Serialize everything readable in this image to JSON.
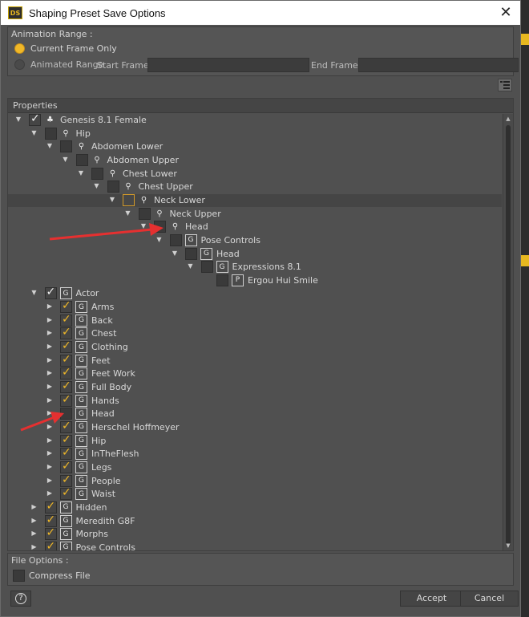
{
  "window": {
    "title": "Shaping Preset Save Options",
    "logo": "DS",
    "close_glyph": "✕"
  },
  "animation_range": {
    "label": "Animation Range :",
    "current_frame_label": "Current Frame Only",
    "animated_range_label": "Animated Range",
    "start_frame_label": "Start Frame :",
    "start_frame_value": "",
    "end_frame_label": "End Frame :",
    "end_frame_value": "",
    "selected": "current_frame"
  },
  "properties": {
    "label": "Properties",
    "rows": [
      {
        "label": "Genesis 8.1 Female",
        "depth": 0,
        "expanded": true,
        "check": "white",
        "icon": "figure-icon"
      },
      {
        "label": "Hip",
        "depth": 1,
        "expanded": true,
        "check": "none",
        "icon": "bone-icon"
      },
      {
        "label": "Abdomen Lower",
        "depth": 2,
        "expanded": true,
        "check": "none",
        "icon": "bone-icon"
      },
      {
        "label": "Abdomen Upper",
        "depth": 3,
        "expanded": true,
        "check": "none",
        "icon": "bone-icon"
      },
      {
        "label": "Chest Lower",
        "depth": 4,
        "expanded": true,
        "check": "none",
        "icon": "bone-icon"
      },
      {
        "label": "Chest Upper",
        "depth": 5,
        "expanded": true,
        "check": "none",
        "icon": "bone-icon"
      },
      {
        "label": "Neck Lower",
        "depth": 6,
        "expanded": true,
        "check": "hover",
        "icon": "bone-icon",
        "highlight": true
      },
      {
        "label": "Neck Upper",
        "depth": 7,
        "expanded": true,
        "check": "none",
        "icon": "bone-icon"
      },
      {
        "label": "Head",
        "depth": 8,
        "expanded": true,
        "check": "none",
        "icon": "bone-icon"
      },
      {
        "label": "Pose Controls",
        "depth": 9,
        "expanded": true,
        "check": "none",
        "icon": "group-icon"
      },
      {
        "label": "Head",
        "depth": 10,
        "expanded": true,
        "check": "none",
        "icon": "group-icon"
      },
      {
        "label": "Expressions 8.1",
        "depth": 11,
        "expanded": true,
        "check": "none",
        "icon": "group-icon"
      },
      {
        "label": "Ergou Hui Smile",
        "depth": 12,
        "expanded": null,
        "check": "none",
        "icon": "property-icon"
      },
      {
        "label": "Actor",
        "depth": 1,
        "expanded": true,
        "check": "white",
        "icon": "group-icon"
      },
      {
        "label": "Arms",
        "depth": 2,
        "expanded": false,
        "check": "yellow",
        "icon": "group-icon"
      },
      {
        "label": "Back",
        "depth": 2,
        "expanded": false,
        "check": "yellow",
        "icon": "group-icon"
      },
      {
        "label": "Chest",
        "depth": 2,
        "expanded": false,
        "check": "yellow",
        "icon": "group-icon"
      },
      {
        "label": "Clothing",
        "depth": 2,
        "expanded": false,
        "check": "yellow",
        "icon": "group-icon"
      },
      {
        "label": "Feet",
        "depth": 2,
        "expanded": false,
        "check": "yellow",
        "icon": "group-icon"
      },
      {
        "label": "Feet Work",
        "depth": 2,
        "expanded": false,
        "check": "yellow",
        "icon": "group-icon"
      },
      {
        "label": "Full Body",
        "depth": 2,
        "expanded": false,
        "check": "yellow",
        "icon": "group-icon"
      },
      {
        "label": "Hands",
        "depth": 2,
        "expanded": false,
        "check": "yellow",
        "icon": "group-icon"
      },
      {
        "label": "Head",
        "depth": 2,
        "expanded": false,
        "check": "none",
        "icon": "group-icon"
      },
      {
        "label": "Herschel Hoffmeyer",
        "depth": 2,
        "expanded": false,
        "check": "yellow",
        "icon": "group-icon"
      },
      {
        "label": "Hip",
        "depth": 2,
        "expanded": false,
        "check": "yellow",
        "icon": "group-icon"
      },
      {
        "label": "InTheFlesh",
        "depth": 2,
        "expanded": false,
        "check": "yellow",
        "icon": "group-icon"
      },
      {
        "label": "Legs",
        "depth": 2,
        "expanded": false,
        "check": "yellow",
        "icon": "group-icon"
      },
      {
        "label": "People",
        "depth": 2,
        "expanded": false,
        "check": "yellow",
        "icon": "group-icon"
      },
      {
        "label": "Waist",
        "depth": 2,
        "expanded": false,
        "check": "yellow",
        "icon": "group-icon"
      },
      {
        "label": "Hidden",
        "depth": 1,
        "expanded": false,
        "check": "yellow",
        "icon": "group-icon"
      },
      {
        "label": "Meredith G8F",
        "depth": 1,
        "expanded": false,
        "check": "yellow",
        "icon": "group-icon"
      },
      {
        "label": "Morphs",
        "depth": 1,
        "expanded": false,
        "check": "yellow",
        "icon": "group-icon"
      },
      {
        "label": "Pose Controls",
        "depth": 1,
        "expanded": false,
        "check": "yellow",
        "icon": "group-icon"
      }
    ]
  },
  "file_options": {
    "label": "File Options :",
    "compress_label": "Compress File",
    "compress_checked": false
  },
  "buttons": {
    "help": "?",
    "accept": "Accept",
    "cancel": "Cancel"
  },
  "colors": {
    "accent": "#f0b828",
    "dialog_bg": "#505050",
    "annotation_arrow": "#e53030"
  }
}
